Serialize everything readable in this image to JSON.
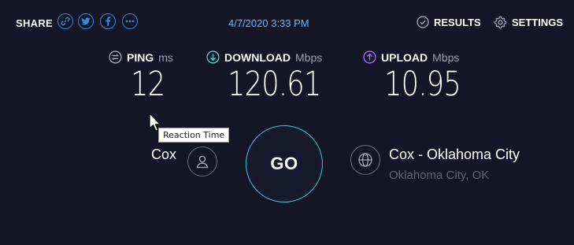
{
  "header": {
    "share_label": "SHARE",
    "share_buttons": [
      "link-icon",
      "twitter-icon",
      "facebook-icon",
      "more-icon"
    ],
    "timestamp": "4/7/2020 3:33 PM",
    "results_label": "RESULTS",
    "settings_label": "SETTINGS"
  },
  "metrics": {
    "ping": {
      "label": "PING",
      "unit": "ms",
      "value": "12"
    },
    "download": {
      "label": "DOWNLOAD",
      "unit": "Mbps",
      "value": "120.61"
    },
    "upload": {
      "label": "UPLOAD",
      "unit": "Mbps",
      "value": "10.95"
    }
  },
  "tooltip": {
    "text": "Reaction Time"
  },
  "provider": {
    "name": "Cox"
  },
  "go_button": {
    "label": "GO"
  },
  "server": {
    "name": "Cox - Oklahoma City",
    "location": "Oklahoma City, OK"
  },
  "colors": {
    "background": "#141526",
    "share_accent": "#2f8bd6",
    "timestamp": "#63b9f2",
    "ping_icon": "#a7abbd",
    "download_icon": "#4fd1d9",
    "upload_icon": "#b06cf5",
    "go_ring": "#4cc3d8"
  }
}
